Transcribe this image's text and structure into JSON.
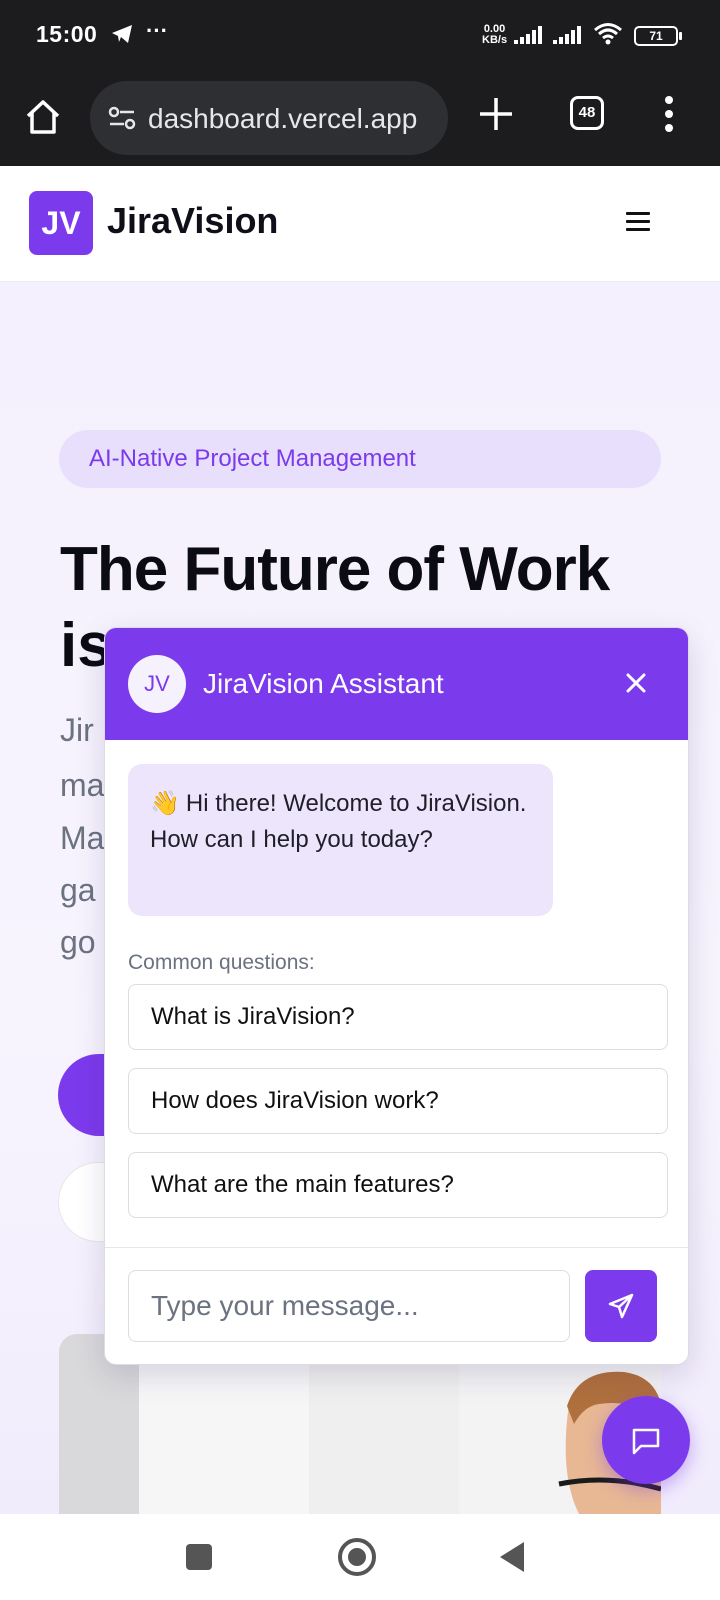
{
  "status_bar": {
    "time": "15:00",
    "more": "···",
    "net_speed_value": "0.00",
    "net_speed_unit": "KB/s",
    "battery": "71",
    "icons": [
      "telegram-icon",
      "signal-icon",
      "signal-icon",
      "wifi-icon",
      "battery-icon"
    ]
  },
  "browser": {
    "url": "dashboard.vercel.app",
    "tab_count": "48",
    "icons": [
      "home-icon",
      "site-settings-icon",
      "plus-icon",
      "tabs-icon",
      "more-vert-icon"
    ]
  },
  "site": {
    "logo_text": "JV",
    "brand": "JiraVision",
    "menu_icon": "hamburger-icon"
  },
  "hero": {
    "badge": "AI-Native Project Management",
    "headline_line1": "The Future of Work",
    "headline_line2_visible": "is",
    "desc_lines": [
      "Jir",
      "ma",
      "Ma",
      "ga",
      "go"
    ]
  },
  "chat": {
    "avatar": "JV",
    "title": "JiraVision Assistant",
    "greeting_emoji": "👋",
    "greeting": "Hi there! Welcome to JiraVision. How can I help you today?",
    "common_label": "Common questions:",
    "questions": [
      "What is JiraVision?",
      "How does JiraVision work?",
      "What are the main features?"
    ],
    "input_placeholder": "Type your message...",
    "colors": {
      "accent": "#7c3aed",
      "bubble": "#ede5fc"
    }
  }
}
